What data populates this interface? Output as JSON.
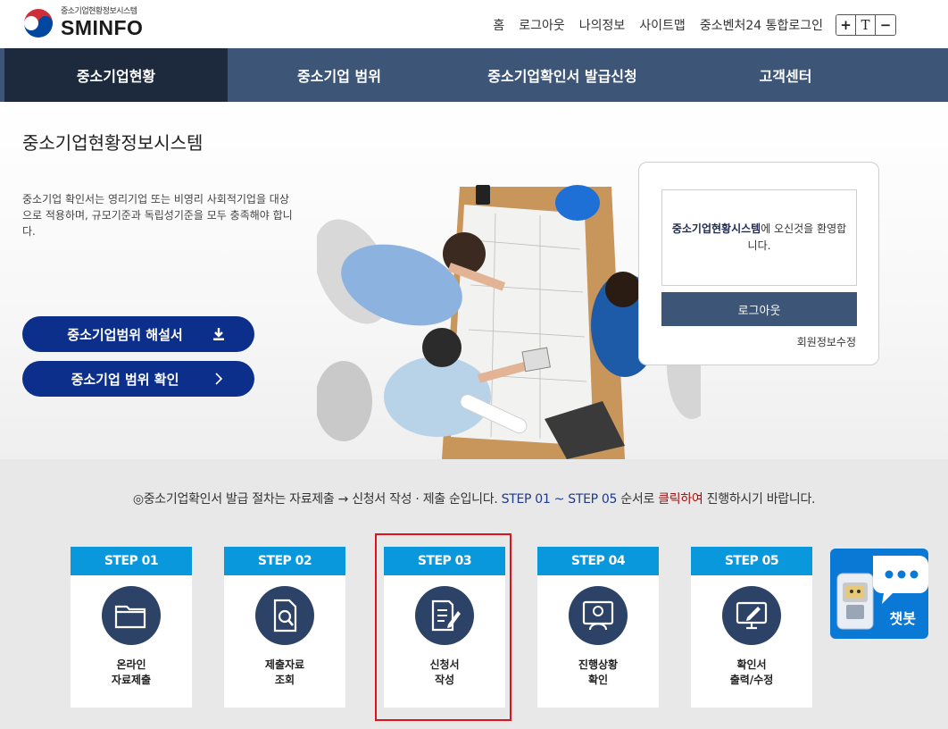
{
  "header": {
    "logo_sub": "중소기업현황정보시스템",
    "logo_main": "SMINFO",
    "top_menu": [
      "홈",
      "로그아웃",
      "나의정보",
      "사이트맵",
      "중소벤처24 통합로그인"
    ],
    "font_controls": [
      "+",
      "T",
      "−"
    ]
  },
  "gnb": {
    "items": [
      "중소기업현황",
      "중소기업 범위",
      "중소기업확인서 발급신청",
      "고객센터"
    ]
  },
  "hero": {
    "title": "중소기업현황정보시스템",
    "description": "중소기업 확인서는 영리기업 또는 비영리 사회적기업을 대상으로 적용하며, 규모기준과 독립성기준을 모두 충족해야 합니다.",
    "btn_guide": "중소기업범위 해설서",
    "btn_check": "중소기업 범위 확인"
  },
  "login": {
    "welcome_bold": "중소기업현황시스템",
    "welcome_rest": "에 오신것을 환영합니다.",
    "logout": "로그아웃",
    "member_edit": "회원정보수정"
  },
  "notice": {
    "prefix": "◎중소기업확인서 발급 절차는 자료제출 → 신청서 작성 · 제출 순입니다. ",
    "steps": "STEP 01 ~ STEP 05",
    "mid": " 순서로 ",
    "click": "클릭하여",
    "suffix": " 진행하시기 바랍니다."
  },
  "steps": [
    {
      "head": "STEP 01",
      "line1": "온라인",
      "line2": "자료제출",
      "icon": "folder-icon"
    },
    {
      "head": "STEP 02",
      "line1": "제출자료",
      "line2": "조회",
      "icon": "document-search-icon"
    },
    {
      "head": "STEP 03",
      "line1": "신청서",
      "line2": "작성",
      "icon": "document-edit-icon"
    },
    {
      "head": "STEP 04",
      "line1": "진행상황",
      "line2": "확인",
      "icon": "user-monitor-icon"
    },
    {
      "head": "STEP 05",
      "line1": "확인서",
      "line2": "출력/수정",
      "icon": "monitor-edit-icon"
    }
  ],
  "chatbot": {
    "label": "챗봇"
  },
  "colors": {
    "nav": "#3d5577",
    "nav_active": "#1d2a3e",
    "hero_btn": "#0d2f8c",
    "step_head": "#0a98dc",
    "step_icon_bg": "#2c4266",
    "highlight": "#e0121b",
    "chatbot": "#0a79d6"
  }
}
